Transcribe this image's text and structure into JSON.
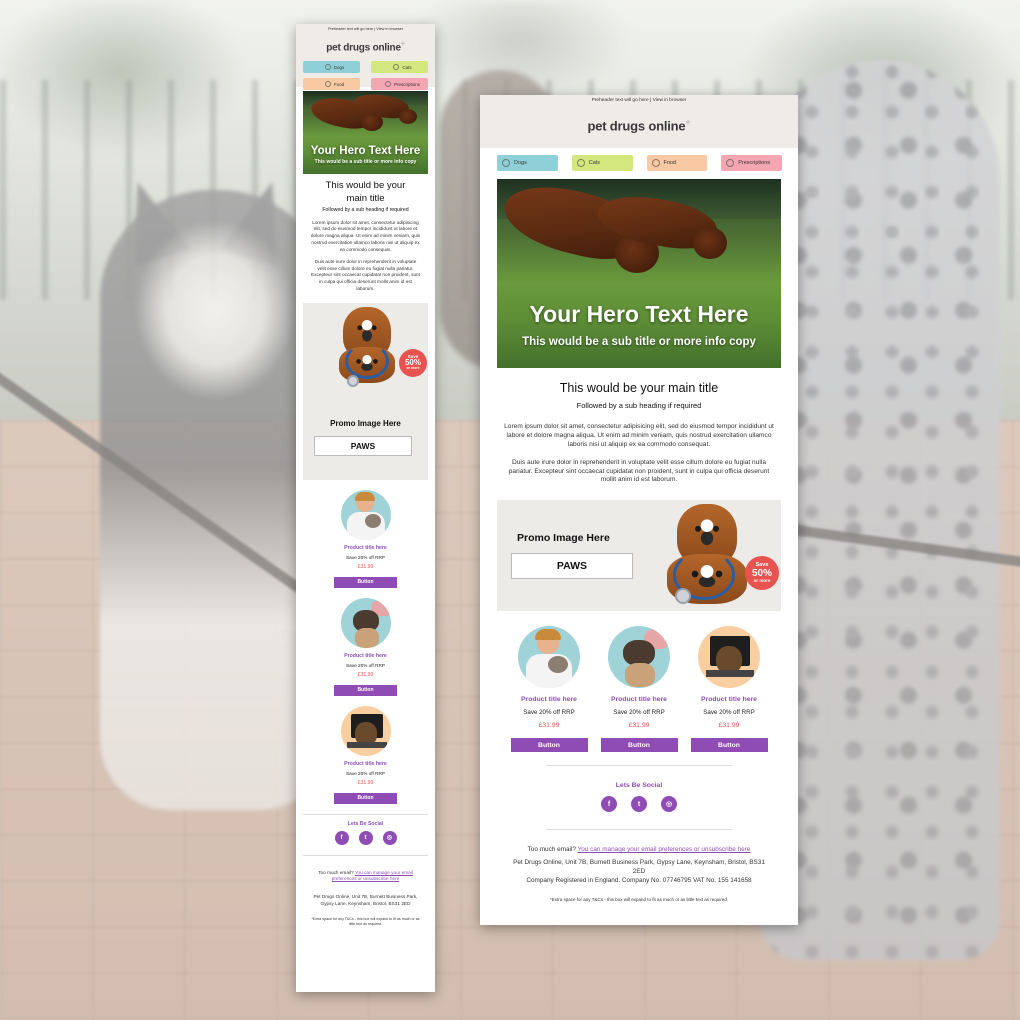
{
  "brand": {
    "logo": "pet drugs online",
    "logo_mark": "+",
    "accent": "#8e4cb4",
    "price_color": "#e05656"
  },
  "preheader": "Preheader text will go here | View in browser",
  "nav": [
    {
      "label": "Dogs",
      "color": "#8fd0d8",
      "icon": "dog-icon"
    },
    {
      "label": "Cats",
      "color": "#d4e67e",
      "icon": "cat-icon"
    },
    {
      "label": "Food",
      "color": "#f8c9a2",
      "icon": "bowl-icon"
    },
    {
      "label": "Prescriptions",
      "color": "#f4a6b3",
      "icon": "stethoscope-icon"
    }
  ],
  "hero": {
    "title": "Your Hero Text Here",
    "subtitle": "This would be a sub title or more info copy"
  },
  "content": {
    "main_title": "This would be your main title",
    "sub_heading": "Followed by a sub heading if required",
    "para1": "Lorem ipsum dolor sit amet, consectetur adipisicing elit, sed do eiusmod tempor incididunt ut labore et dolore magna aliqua. Ut enim ad minim veniam, quis nostrud exercitation ullamco laboris nisi ut aliquip ex ea commodo consequat.",
    "para2": "Duis aute irure dolor in reprehenderit in voluptate velit esse cillum dolore eu fugiat nulla pariatur. Excepteur sint occaecat cupidatat non proident, sunt in culpa qui officia deserunt mollit anim id est laborum."
  },
  "promo": {
    "title": "Promo Image Here",
    "code": "PAWS",
    "badge_top": "Save",
    "badge_big": "50%",
    "badge_bottom": "or more"
  },
  "products": [
    {
      "title": "Product title here",
      "save": "Save 20% off RRP",
      "price": "£31.99",
      "button": "Button",
      "image": "vet-with-cat"
    },
    {
      "title": "Product title here",
      "save": "Save 20% off RRP",
      "price": "£31.99",
      "button": "Button",
      "image": "chihuahua"
    },
    {
      "title": "Product title here",
      "save": "Save 20% off RRP",
      "price": "£31.99",
      "button": "Button",
      "image": "dog-with-laptop"
    }
  ],
  "social": {
    "title": "Lets Be Social",
    "icons": [
      "facebook-icon",
      "twitter-icon",
      "instagram-icon"
    ],
    "glyphs": [
      "f",
      "t",
      "◎"
    ]
  },
  "footer": {
    "too_much": "Too much email?",
    "manage_link": "You can manage your email preferences or unsubscribe here",
    "address": "Pet Drugs Online, Unit 7B, Burnett Business Park, Gypsy Lane, Keynsham, Bristol, BS31 2ED",
    "company": "Company Registered in England. Company No. 07746795 VAT No. 155 141658",
    "tcs": "*Extra space for any T&Cs - this box will expand to fit as much or as little text as required."
  }
}
